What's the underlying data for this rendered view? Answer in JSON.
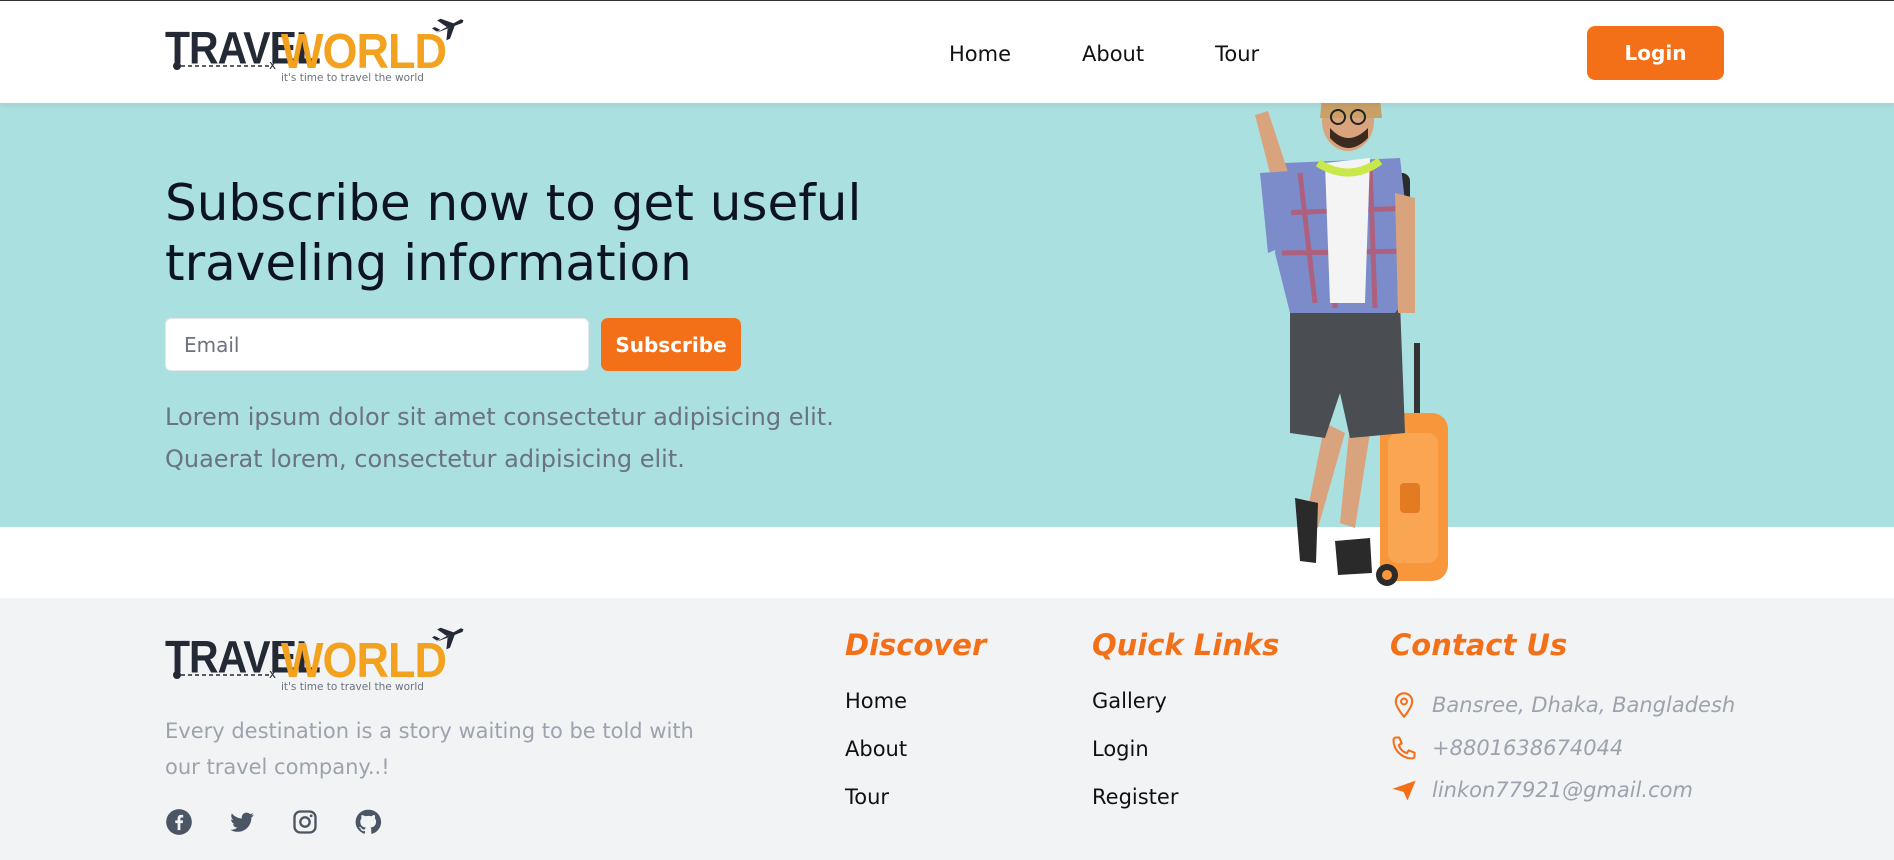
{
  "brand": {
    "name_part1": "TRAVEL",
    "name_part2": "WORLD",
    "tagline": "it's time to travel the world"
  },
  "nav": {
    "links": [
      {
        "label": "Home"
      },
      {
        "label": "About"
      },
      {
        "label": "Tour"
      }
    ],
    "login_label": "Login"
  },
  "subscribe": {
    "title": "Subscribe now to get useful traveling information",
    "email_placeholder": "Email",
    "button_label": "Subscribe",
    "description": "Lorem ipsum dolor sit amet consectetur adipisicing elit. Quaerat lorem, consectetur adipisicing elit."
  },
  "footer": {
    "description": "Every destination is a story waiting to be told with our travel company..!",
    "socials": [
      "facebook-icon",
      "twitter-icon",
      "instagram-icon",
      "github-icon"
    ],
    "discover": {
      "title": "Discover",
      "items": [
        "Home",
        "About",
        "Tour"
      ]
    },
    "quick_links": {
      "title": "Quick Links",
      "items": [
        "Gallery",
        "Login",
        "Register"
      ]
    },
    "contact": {
      "title": "Contact Us",
      "address": "Bansree, Dhaka, Bangladesh",
      "phone": "+8801638674044",
      "email": "linkon77921@gmail.com"
    }
  },
  "colors": {
    "accent": "#f37018",
    "hero_bg": "#abe0e0",
    "footer_bg": "#f2f3f5",
    "logo_dark": "#232a35",
    "logo_orange": "#f2a21e"
  }
}
